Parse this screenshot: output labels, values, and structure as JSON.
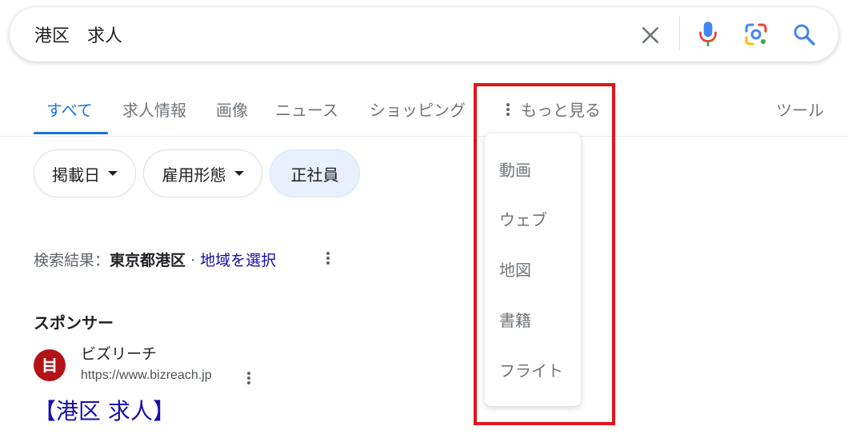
{
  "search": {
    "query": "港区　求人"
  },
  "tabs": {
    "all": "すべて",
    "jobs": "求人情報",
    "images": "画像",
    "news": "ニュース",
    "shopping": "ショッピング",
    "more": "もっと見る",
    "tools": "ツール"
  },
  "chips": {
    "posted_date": "掲載日",
    "employment_type": "雇用形態",
    "fulltime": "正社員"
  },
  "location": {
    "prefix": "検索結果：",
    "place": "東京都港区",
    "separator": " · ",
    "choose": "地域を選択"
  },
  "ad": {
    "sponsor_label": "スポンサー",
    "site_name": "ビズリーチ",
    "url": "https://www.bizreach.jp",
    "title": "【港区 求人】"
  },
  "more_menu": {
    "items": [
      "動画",
      "ウェブ",
      "地図",
      "書籍",
      "フライト"
    ]
  },
  "colors": {
    "accent": "#1a73e8",
    "link": "#1a0dab",
    "highlight": "#e3141b",
    "favicon": "#b31217"
  }
}
